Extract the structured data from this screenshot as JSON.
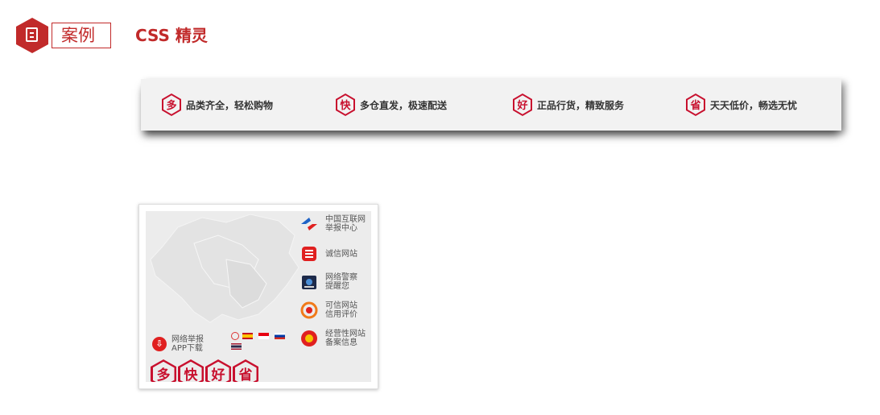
{
  "header": {
    "badge_icon": "document-icon",
    "case_label": "案例",
    "title": "CSS 精灵"
  },
  "banner": {
    "items": [
      {
        "badge": "多",
        "text": "品类齐全，轻松购物"
      },
      {
        "badge": "快",
        "text": "多仓直发，极速配送"
      },
      {
        "badge": "好",
        "text": "正品行货，精致服务"
      },
      {
        "badge": "省",
        "text": "天天低价，畅选无忧"
      }
    ]
  },
  "sprite": {
    "app_download": {
      "line1": "网络举报",
      "line2": "APP下载"
    },
    "links": [
      {
        "icon": "china-internet-report-icon",
        "line1": "中国互联网",
        "line2": "举报中心"
      },
      {
        "icon": "credit-site-icon",
        "line1": "诚信网站",
        "line2": ""
      },
      {
        "icon": "police-icon",
        "line1": "网络警察",
        "line2": "提醒您"
      },
      {
        "icon": "trust-rating-icon",
        "line1": "可信网站",
        "line2": "信用评价"
      },
      {
        "icon": "business-license-icon",
        "line1": "经营性网站",
        "line2": "备案信息"
      }
    ],
    "badges": [
      "多",
      "快",
      "好",
      "省"
    ]
  },
  "colors": {
    "brand_red": "#c12a2a",
    "badge_red": "#c8102e"
  }
}
